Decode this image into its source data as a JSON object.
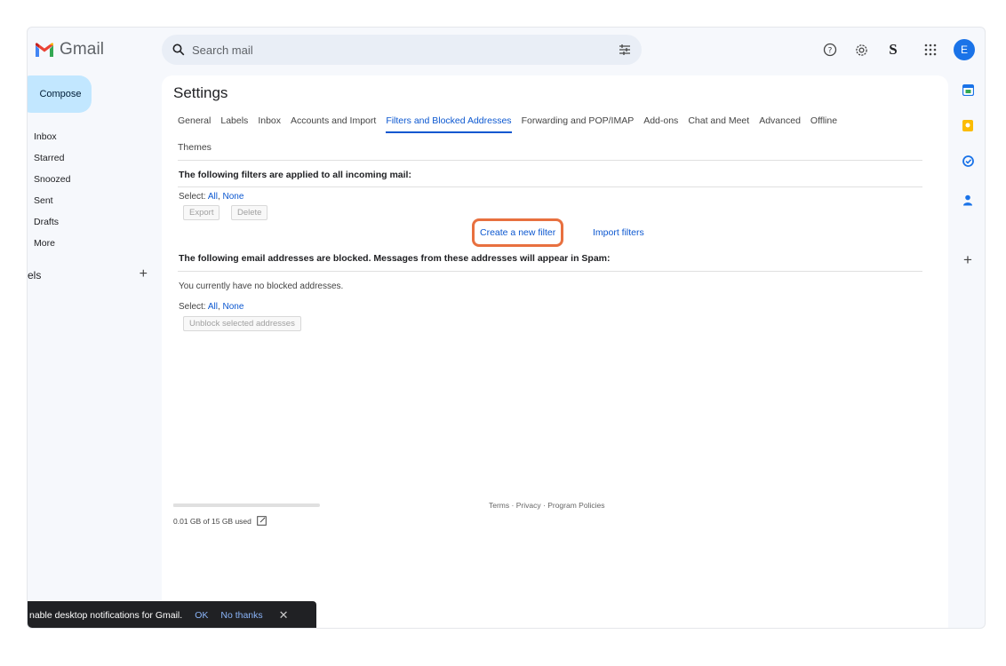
{
  "app": {
    "name": "Gmail"
  },
  "search": {
    "placeholder": "Search mail"
  },
  "header": {
    "avatar_letter": "E",
    "org_logo_letter": "S"
  },
  "nav": {
    "compose_label": "Compose",
    "items": [
      "Inbox",
      "Starred",
      "Snoozed",
      "Sent",
      "Drafts",
      "More"
    ],
    "labels_heading": "els"
  },
  "settings": {
    "title": "Settings",
    "tabs": [
      "General",
      "Labels",
      "Inbox",
      "Accounts and Import",
      "Filters and Blocked Addresses",
      "Forwarding and POP/IMAP",
      "Add-ons",
      "Chat and Meet",
      "Advanced",
      "Offline",
      "Themes"
    ],
    "active_tab": "Filters and Blocked Addresses",
    "filters": {
      "heading": "The following filters are applied to all incoming mail:",
      "select_label": "Select:",
      "select_all": "All",
      "select_none": "None",
      "export_label": "Export",
      "delete_label": "Delete",
      "create_label": "Create a new filter",
      "import_label": "Import filters"
    },
    "blocked": {
      "heading": "The following email addresses are blocked. Messages from these addresses will appear in Spam:",
      "empty_text": "You currently have no blocked addresses.",
      "select_label": "Select:",
      "select_all": "All",
      "select_none": "None",
      "unblock_label": "Unblock selected addresses"
    }
  },
  "storage": {
    "used_text": "0.01 GB of 15 GB used",
    "used_fraction": 0.0007
  },
  "footer": {
    "terms": "Terms",
    "privacy": "Privacy",
    "policies": "Program Policies",
    "separator": "·"
  },
  "toast": {
    "message": "nable desktop notifications for Gmail.",
    "ok_label": "OK",
    "no_thanks_label": "No thanks",
    "close_glyph": "✕"
  },
  "colors": {
    "accent": "#0b57d0",
    "compose_bg": "#c2e7ff",
    "highlight": "#e8703f",
    "avatar_bg": "#1a73e8"
  }
}
